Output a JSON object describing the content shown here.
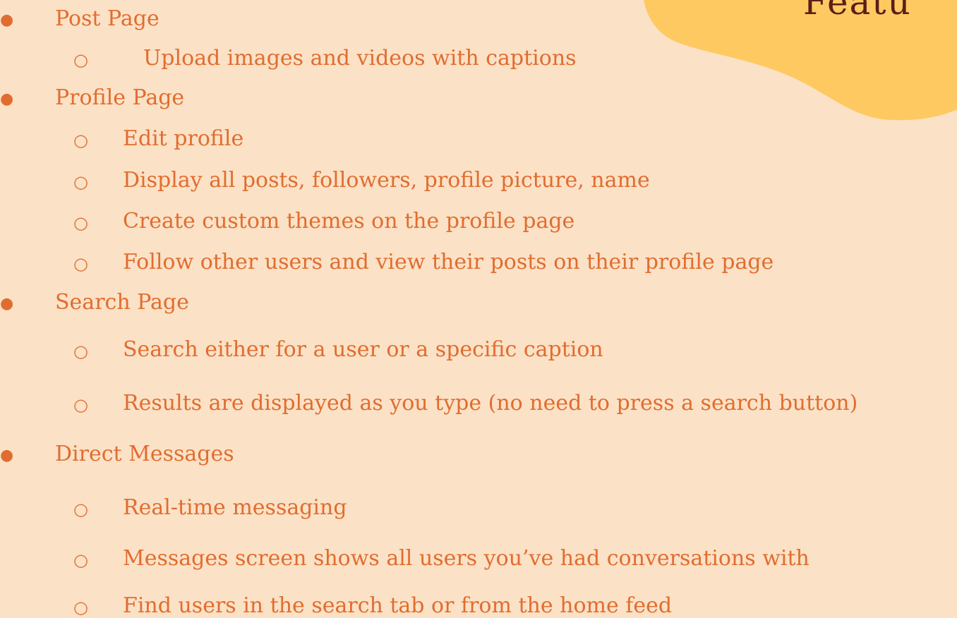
{
  "slide": {
    "title": "Featu",
    "accent_color": "#fec961",
    "text_color": "#e06d2f",
    "title_color": "#5a1f16",
    "background_color": "#fbe1c6"
  },
  "bullets": {
    "level1_symbol": "●",
    "level2_symbol": "○"
  },
  "sections": [
    {
      "label": "Post Page",
      "items": [
        "Upload images and videos with captions"
      ]
    },
    {
      "label": "Profile Page",
      "items": [
        "Edit profile",
        "Display all posts, followers, profile picture, name",
        "Create custom themes on the profile page",
        "Follow other users and view their posts on their profile page"
      ]
    },
    {
      "label": "Search Page",
      "items": [
        "Search either for a user or a specific caption",
        "Results are displayed as you type (no need to press a search button)"
      ]
    },
    {
      "label": "Direct Messages",
      "items": [
        "Real-time messaging",
        "Messages screen shows all users you’ve had conversations with",
        "Find users in the search tab or from the home feed"
      ]
    }
  ]
}
